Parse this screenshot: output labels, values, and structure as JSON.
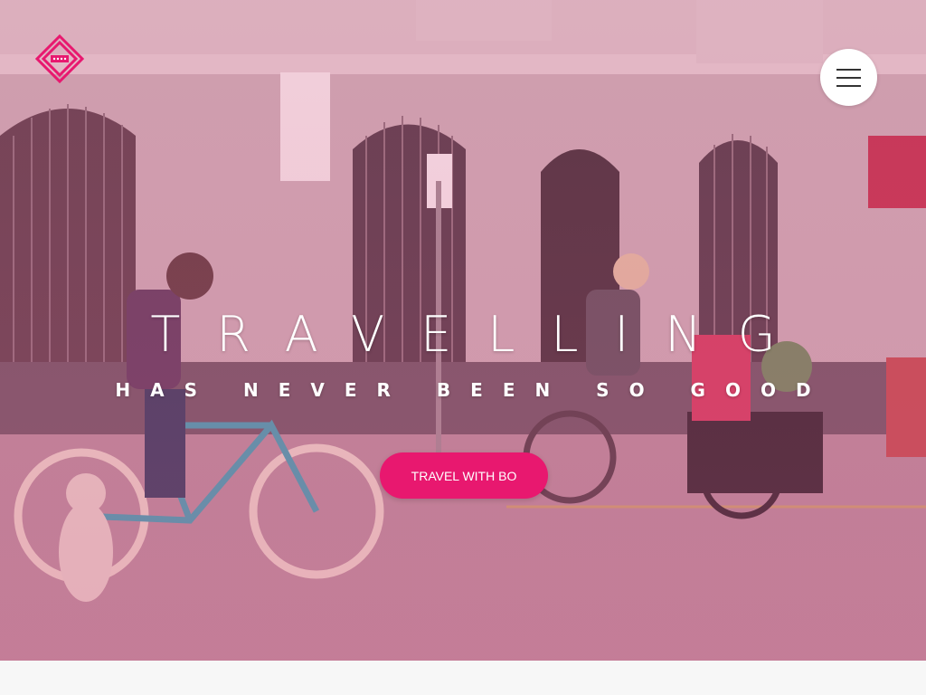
{
  "hero": {
    "headline": "TRAVELLING",
    "subheadline": "HAS NEVER BEEN SO GOOD",
    "cta_label": "TRAVEL WITH BO",
    "background_icon": "street-cyclists-photo"
  },
  "header": {
    "logo_icon": "diamond-logo-icon",
    "menu_icon": "hamburger-menu-icon"
  },
  "colors": {
    "accent": "#e8186f",
    "overlay": "#e85a96",
    "menu_button_bg": "#ffffff"
  }
}
